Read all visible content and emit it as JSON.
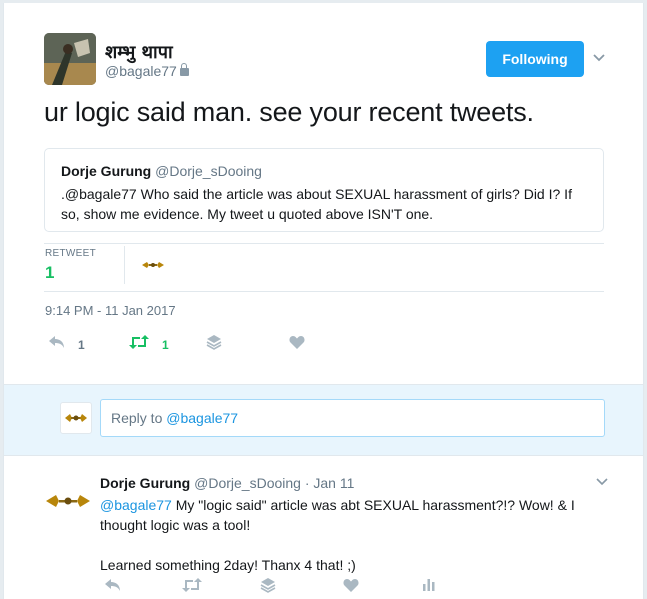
{
  "tweet": {
    "author_name": "शम्भु थापा",
    "author_handle": "@bagale77",
    "follow_label": "Following",
    "text": "ur logic said man. see your recent tweets.",
    "quoted": {
      "author_name": "Dorje Gurung",
      "author_handle": "@Dorje_sDooing",
      "text": ".@bagale77 Who said the article was about SEXUAL harassment of girls? Did I? If so, show me evidence. My tweet u quoted above ISN'T one."
    },
    "stats": {
      "retweet_label": "RETWEET",
      "retweet_count": "1"
    },
    "timestamp": "9:14 PM - 11 Jan 2017",
    "actions": {
      "reply_count": "1",
      "retweet_count": "1"
    }
  },
  "reply_box": {
    "placeholder_prefix": "Reply to ",
    "placeholder_mention": "@bagale77"
  },
  "reply": {
    "author_name": "Dorje Gurung",
    "author_handle": "@Dorje_sDooing",
    "date": "· Jan 11",
    "mention": "@bagale77",
    "text_line1": " My \"logic said\" article was abt SEXUAL harassment?!? Wow! & I thought logic was a tool!",
    "text_line2": "Learned something 2day! Thanx 4 that! ;)"
  },
  "colors": {
    "accent": "#1da1f2",
    "retweet_green": "#17bf63",
    "muted": "#657786"
  }
}
